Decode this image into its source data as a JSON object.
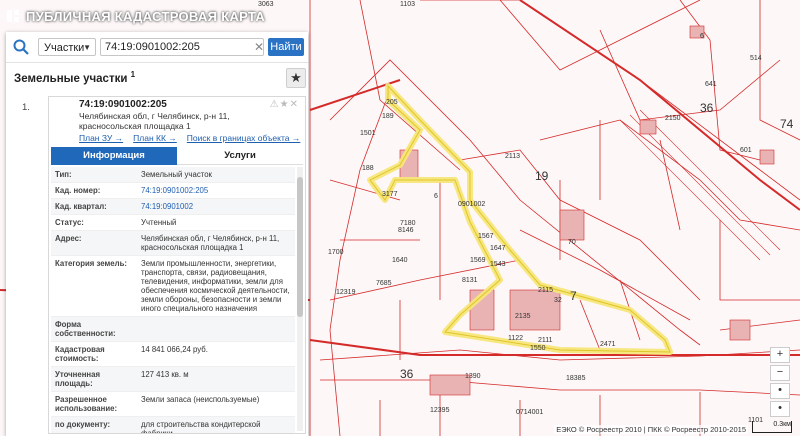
{
  "app": {
    "title": "ПУБЛИЧНАЯ КАДАСТРОВАЯ КАРТА"
  },
  "search": {
    "type": "Участки",
    "query": "74:19:0901002:205",
    "button": "Найти"
  },
  "results": {
    "title": "Земельные участки",
    "count": "1",
    "item": {
      "index": "1.",
      "cad_number": "74:19:0901002:205",
      "address": "Челябинская обл, г Челябинск, р-н 11, красносольская площадка 1",
      "links": [
        "План ЗУ →",
        "План КК →",
        "Поиск в границах объекта →"
      ]
    },
    "tabs": [
      "Информация",
      "Услуги"
    ],
    "rows": [
      {
        "k": "Тип:",
        "v": "Земельный участок"
      },
      {
        "k": "Кад. номер:",
        "v": "74:19:0901002:205"
      },
      {
        "k": "Кад. квартал:",
        "v": "74:19:0901002"
      },
      {
        "k": "Статус:",
        "v": "Учтенный"
      },
      {
        "k": "Адрес:",
        "v": "Челябинская обл, г Челябинск, р-н 11, красносольская площадка 1"
      },
      {
        "k": "Категория земель:",
        "v": "Земли промышленности, энергетики, транспорта, связи, радиовещания, телевидения, информатики, земли для обеспечения космической деятельности, земли обороны, безопасности и земли иного специального назначения"
      },
      {
        "k": "Форма собственности:",
        "v": ""
      },
      {
        "k": "Кадастровая стоимость:",
        "v": "14 841 066,24 руб."
      },
      {
        "k": "Уточненная площадь:",
        "v": "127 413 кв. м"
      },
      {
        "k": "Разрешенное использование:",
        "v": "Земли запаса (неиспользуемые)"
      },
      {
        "k": "по документу:",
        "v": "для строительства кондитерской фабрики,"
      }
    ]
  },
  "map": {
    "labels": [
      "3063",
      "1103",
      "19",
      "7",
      "36",
      "74",
      "601",
      "514",
      "6",
      "641",
      "1101",
      "2113",
      "188",
      "189",
      "7180",
      "8146",
      "1640",
      "1567",
      "1647",
      "7685",
      "8131",
      "12319",
      "2115",
      "2135",
      "2111",
      "18385",
      "0714001",
      "1390",
      "12395",
      "2471",
      "36",
      "205",
      "3177",
      "1501",
      "1700",
      "70",
      "32",
      "0901002",
      "1569",
      "1543",
      "6",
      "1122",
      "1550",
      "2150"
    ]
  },
  "footer": "ЕЭКО © Росреестр 2010 | ПКК © Росреестр 2010-2015",
  "scale": "0.3км",
  "zoom": [
    "+",
    "−",
    "•",
    "•"
  ],
  "colors": {
    "cad_line": "#d42a2a",
    "highlight": "#f7e67a",
    "accent": "#1f68ba"
  }
}
